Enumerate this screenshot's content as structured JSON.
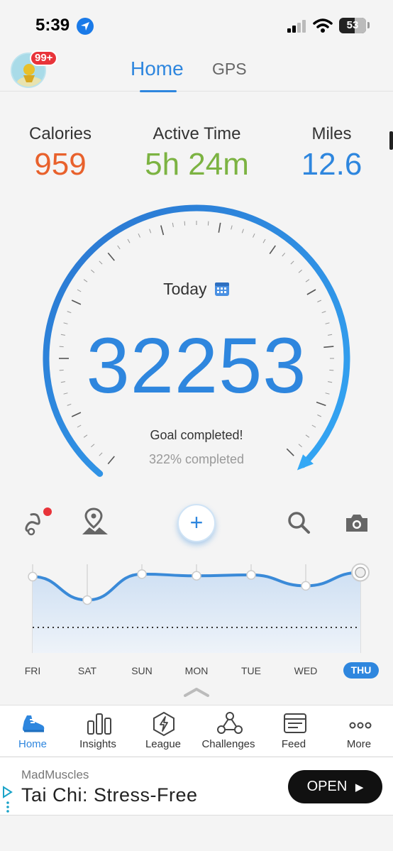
{
  "status_bar": {
    "time": "5:39",
    "battery": "53"
  },
  "header": {
    "notification_badge": "99+",
    "tabs": [
      {
        "label": "Home",
        "active": true
      },
      {
        "label": "GPS",
        "active": false
      }
    ]
  },
  "stats": [
    {
      "label": "Calories",
      "value": "959",
      "color": "#e8612c"
    },
    {
      "label": "Active Time",
      "value": "5h 24m",
      "color": "#7cb342"
    },
    {
      "label": "Miles",
      "value": "12.6",
      "color": "#2e86de"
    }
  ],
  "gauge": {
    "period_label": "Today",
    "steps": "32253",
    "goal_text": "Goal completed!",
    "percent_text": "322% completed",
    "progress_percent": 322
  },
  "actions": [
    {
      "icon": "route-icon",
      "has_dot": true
    },
    {
      "icon": "map-pin-icon"
    },
    {
      "icon": "add-icon",
      "label": "+"
    },
    {
      "icon": "search-icon"
    },
    {
      "icon": "camera-icon"
    }
  ],
  "week": {
    "days": [
      "FRI",
      "SAT",
      "SUN",
      "MON",
      "TUE",
      "WED",
      "THU"
    ],
    "active_day": "THU",
    "relative_levels": [
      0.81,
      0.53,
      0.84,
      0.82,
      0.83,
      0.7,
      0.86
    ],
    "goal_line_level": 0.0
  },
  "bottom_nav": [
    {
      "label": "Home",
      "icon": "shoe-icon",
      "active": true
    },
    {
      "label": "Insights",
      "icon": "bar-chart-icon"
    },
    {
      "label": "League",
      "icon": "lightning-hexagon-icon"
    },
    {
      "label": "Challenges",
      "icon": "people-triangle-icon"
    },
    {
      "label": "Feed",
      "icon": "feed-icon"
    },
    {
      "label": "More",
      "icon": "more-dots-icon"
    }
  ],
  "ad": {
    "brand": "MadMuscles",
    "title": "Tai Chi: Stress-Free",
    "button": "OPEN"
  },
  "colors": {
    "accent": "#2e86de",
    "calories": "#e8612c",
    "active_time": "#7cb342",
    "badge": "#e8343a"
  }
}
